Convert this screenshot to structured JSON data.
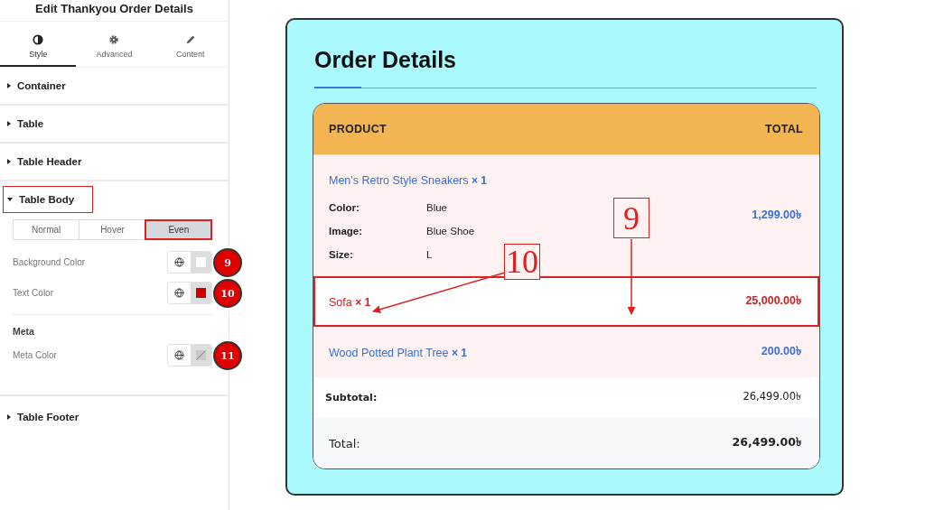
{
  "panel": {
    "title": "Edit Thankyou Order Details",
    "tabs": [
      {
        "label": "Style",
        "kind": "contrast",
        "selected": true
      },
      {
        "label": "Advanced",
        "kind": "gear",
        "selected": false
      },
      {
        "label": "Content",
        "kind": "pencil",
        "selected": false
      }
    ],
    "sections": [
      {
        "label": "Container",
        "expanded": false,
        "highlighted": false
      },
      {
        "label": "Table",
        "expanded": false,
        "highlighted": false
      },
      {
        "label": "Table Header",
        "expanded": false,
        "highlighted": false
      },
      {
        "label": "Table Body",
        "expanded": true,
        "highlighted": true
      }
    ],
    "state_tabs": [
      {
        "label": "Normal",
        "selected": false
      },
      {
        "label": "Hover",
        "selected": false
      },
      {
        "label": "Even",
        "selected": true
      }
    ],
    "controls": [
      {
        "label": "Background Color",
        "kind": "swatch",
        "color": "#ffffff",
        "badge": "9"
      },
      {
        "label": "Text Color",
        "kind": "swatch",
        "color": "#cc0000",
        "badge": "10"
      }
    ],
    "meta": {
      "heading": "Meta",
      "controls": [
        {
          "label": "Meta Color",
          "kind": "cleared",
          "badge": "11"
        }
      ]
    },
    "footer_section": {
      "label": "Table Footer",
      "expanded": false
    }
  },
  "order": {
    "title": "Order Details",
    "columns": [
      "PRODUCT",
      "TOTAL"
    ],
    "items": [
      {
        "name": "Men's Retro Style Sneakers",
        "qty": "× 1",
        "total": "1,299.00৳",
        "even": false,
        "highlighted": false,
        "meta": [
          {
            "label": "Color:",
            "value": "Blue"
          },
          {
            "label": "Image:",
            "value": "Blue Shoe"
          },
          {
            "label": "Size:",
            "value": "L"
          }
        ]
      },
      {
        "name": "Sofa",
        "qty": "× 1",
        "total": "25,000.00৳",
        "even": true,
        "highlighted": true
      },
      {
        "name": "Wood Potted Plant Tree",
        "qty": "× 1",
        "total": "200.00৳",
        "even": false,
        "highlighted": false
      }
    ],
    "totals": [
      {
        "label": "Subtotal:",
        "value": "26,499.00৳",
        "kind": "subtotal"
      },
      {
        "label": "Total:",
        "value": "26,499.00৳",
        "kind": "total"
      }
    ]
  },
  "callouts": [
    {
      "label": "9"
    },
    {
      "label": "10"
    }
  ]
}
